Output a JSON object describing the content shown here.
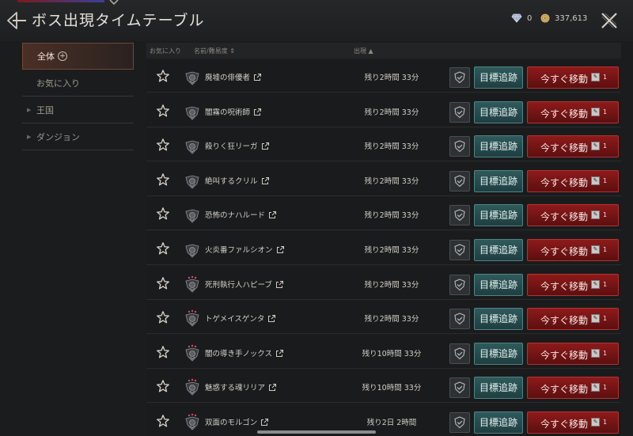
{
  "header": {
    "title": "ボス出現タイムテーブル",
    "diamonds": "0",
    "gold": "337,613"
  },
  "sidebar": {
    "items": [
      {
        "label": "全体",
        "badge": "+",
        "active": true
      },
      {
        "label": "お気に入り"
      },
      {
        "label": "王国",
        "expandable": true
      },
      {
        "label": "ダンジョン",
        "expandable": true
      }
    ]
  },
  "table": {
    "headers": {
      "favorite": "お気に入り",
      "name": "名前/難易度",
      "name_sort_icon": "⇕",
      "spawn": "出現",
      "spawn_sort_icon": "▲"
    },
    "track_label": "目標追跡",
    "move_label": "今すぐ移動",
    "move_cost": "1",
    "rows": [
      {
        "name": "廃墟の俳優者",
        "time": "残り2時間 33分"
      },
      {
        "name": "闇霧の呪術師",
        "time": "残り2時間 33分"
      },
      {
        "name": "殺りく狂リーガ",
        "time": "残り2時間 33分"
      },
      {
        "name": "絶叫するクリル",
        "time": "残り2時間 33分"
      },
      {
        "name": "恐怖のナハルード",
        "time": "残り2時間 33分"
      },
      {
        "name": "火炎番ファルシオン",
        "time": "残り2時間 33分"
      },
      {
        "name": "死刑執行人ハピーブ",
        "time": "残り2時間 33分"
      },
      {
        "name": "トゲメイスゲンタ",
        "time": "残り2時間 33分"
      },
      {
        "name": "闇の導き手ノックス",
        "time": "残り10時間 33分"
      },
      {
        "name": "魅惑する魂リリア",
        "time": "残り10時間 33分"
      },
      {
        "name": "双面のモルゴン",
        "time": "残り2日 2時間"
      }
    ]
  },
  "colors": {
    "track_button": "#2f5a5b",
    "move_button": "#8e1a1a",
    "active_tab": "#4a2f26"
  }
}
